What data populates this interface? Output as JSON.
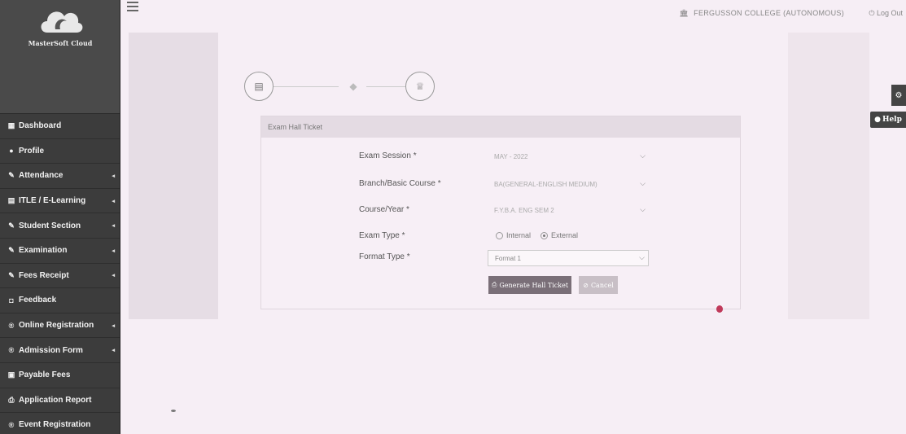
{
  "sidebar": {
    "brand": "MasterSoft Cloud",
    "items": [
      {
        "icon": "dashboard-icon",
        "glyph": "▦",
        "label": "Dashboard",
        "has_submenu": false
      },
      {
        "icon": "user-icon",
        "glyph": "●",
        "label": "Profile",
        "has_submenu": false
      },
      {
        "icon": "pencil-icon",
        "glyph": "✎",
        "label": "Attendance",
        "has_submenu": true
      },
      {
        "icon": "institution-icon",
        "glyph": "▤",
        "label": "ITLE / E-Learning",
        "has_submenu": true
      },
      {
        "icon": "pencil-icon",
        "glyph": "✎",
        "label": "Student Section",
        "has_submenu": true
      },
      {
        "icon": "pencil-icon",
        "glyph": "✎",
        "label": "Examination",
        "has_submenu": true
      },
      {
        "icon": "pencil-icon",
        "glyph": "✎",
        "label": "Fees Receipt",
        "has_submenu": true
      },
      {
        "icon": "feedback-icon",
        "glyph": "◘",
        "label": "Feedback",
        "has_submenu": false
      },
      {
        "icon": "registered-icon",
        "glyph": "®",
        "label": "Online Registration",
        "has_submenu": true
      },
      {
        "icon": "registered-icon",
        "glyph": "®",
        "label": "Admission Form",
        "has_submenu": true
      },
      {
        "icon": "money-icon",
        "glyph": "▣",
        "label": "Payable Fees",
        "has_submenu": false
      },
      {
        "icon": "print-icon",
        "glyph": "⎙",
        "label": "Application Report",
        "has_submenu": false
      },
      {
        "icon": "registered-icon",
        "glyph": "®",
        "label": "Event Registration",
        "has_submenu": false
      }
    ]
  },
  "topbar": {
    "college": "FERGUSSON COLLEGE (AUTONOMOUS)",
    "logout": "Log Out"
  },
  "panel": {
    "title": "Exam Hall Ticket",
    "fields": [
      {
        "label": "Exam Session *",
        "value": "MAY - 2022",
        "type": "select"
      },
      {
        "label": "Branch/Basic Course *",
        "value": "BA(GENERAL-ENGLISH MEDIUM)",
        "type": "select"
      },
      {
        "label": "Course/Year *",
        "value": "F.Y.B.A. ENG SEM 2",
        "type": "select"
      },
      {
        "label": "Exam Type *",
        "type": "radio"
      },
      {
        "label": "Format Type *",
        "value": "Format 1",
        "type": "select"
      }
    ],
    "exam_type": {
      "internal": "Internal",
      "external": "External",
      "selected": "External"
    },
    "buttons": {
      "generate": "Generate Hall Ticket",
      "cancel": "Cancel"
    }
  },
  "help": "Help"
}
